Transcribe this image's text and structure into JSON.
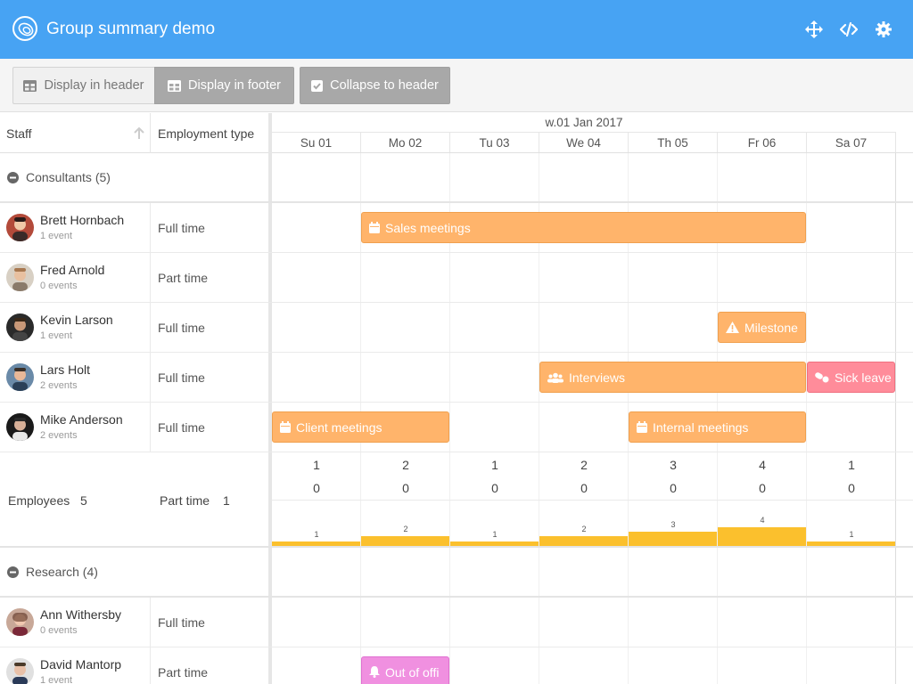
{
  "app": {
    "title": "Group summary demo"
  },
  "toolbar": {
    "display_header": "Display in header",
    "display_footer": "Display in footer",
    "collapse": "Collapse to header"
  },
  "columns": {
    "staff": "Staff",
    "employment": "Employment type"
  },
  "timeline": {
    "week": "w.01 Jan 2017",
    "days": [
      "Su 01",
      "Mo 02",
      "Tu 03",
      "We 04",
      "Th 05",
      "Fr 06",
      "Sa 07"
    ]
  },
  "groups": [
    {
      "label": "Consultants (5)",
      "staff": [
        {
          "name": "Brett Hornbach",
          "events": "1 event",
          "type": "Full time"
        },
        {
          "name": "Fred Arnold",
          "events": "0 events",
          "type": "Part time"
        },
        {
          "name": "Kevin Larson",
          "events": "1 event",
          "type": "Full time"
        },
        {
          "name": "Lars Holt",
          "events": "2 events",
          "type": "Full time"
        },
        {
          "name": "Mike Anderson",
          "events": "2 events",
          "type": "Full time"
        }
      ],
      "summary": {
        "employees_label": "Employees",
        "employees_count": "5",
        "parttime_label": "Part time",
        "parttime_count": "1",
        "row1": [
          "1",
          "2",
          "1",
          "2",
          "3",
          "4",
          "1"
        ],
        "row2": [
          "0",
          "0",
          "0",
          "0",
          "0",
          "0",
          "0"
        ],
        "bars": [
          1,
          2,
          1,
          2,
          3,
          4,
          1
        ]
      }
    },
    {
      "label": "Research (4)",
      "staff": [
        {
          "name": "Ann Withersby",
          "events": "0 events",
          "type": "Full time"
        },
        {
          "name": "David Mantorp",
          "events": "1 event",
          "type": "Part time"
        }
      ]
    }
  ],
  "events": {
    "sales": "Sales meetings",
    "milestone": "Milestone",
    "interviews": "Interviews",
    "sick": "Sick leave",
    "client": "Client meetings",
    "internal": "Internal meetings",
    "ooo": "Out of offi"
  },
  "icons": [
    "logo-icon",
    "fullscreen-icon",
    "code-icon",
    "settings-icon",
    "table-icon",
    "check-icon",
    "sort-up-icon",
    "collapse-icon",
    "calendar-icon",
    "warning-icon",
    "group-icon",
    "pills-icon",
    "bell-icon"
  ],
  "colors": {
    "header": "#47a3f3",
    "event": "#ffb46b",
    "sick": "#ff8c9a",
    "ooo": "#f090e0",
    "bar": "#fbc02d"
  }
}
